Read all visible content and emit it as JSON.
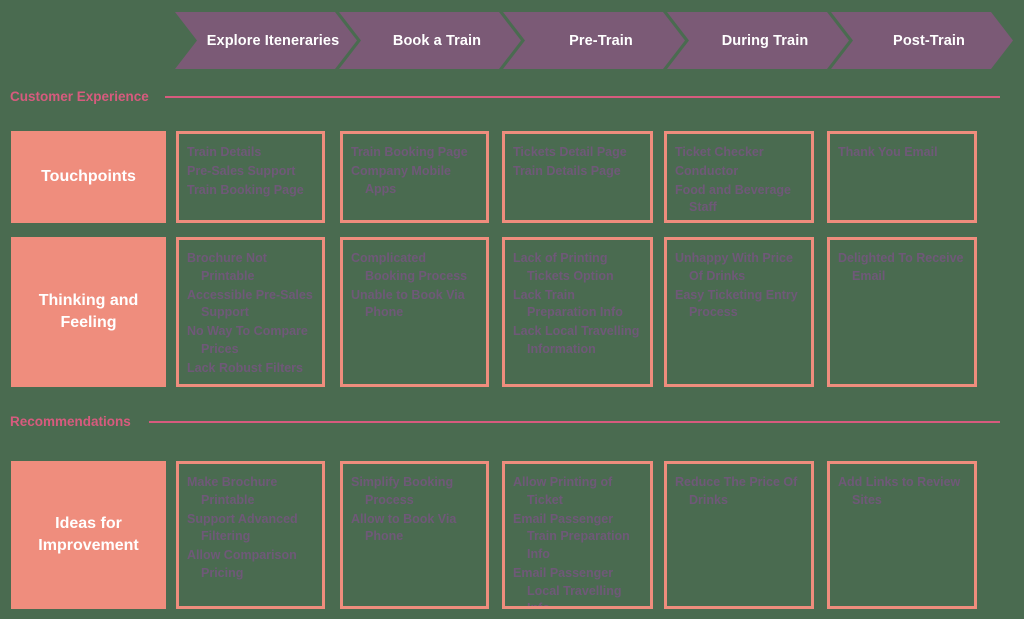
{
  "colors": {
    "background": "#4a6b50",
    "phase_bar": "#7b5a76",
    "accent_pink": "#d75b7e",
    "label_salmon": "#ef8d7d",
    "cell_text": "#6f5878",
    "phase_text": "#ffffff"
  },
  "phases": [
    {
      "label": "Explore Iteneraries"
    },
    {
      "label": "Book a Train"
    },
    {
      "label": "Pre-Train"
    },
    {
      "label": "During Train"
    },
    {
      "label": "Post-Train"
    }
  ],
  "sections": [
    {
      "id": "customer-experience",
      "title": "Customer Experience"
    },
    {
      "id": "recommendations",
      "title": "Recommendations"
    }
  ],
  "rows": [
    {
      "id": "touchpoints",
      "label": "Touchpoints",
      "cells": [
        {
          "items": [
            "Train Details",
            "Pre-Sales Support",
            "Train Booking Page"
          ]
        },
        {
          "items": [
            "Train Booking Page",
            "Company Mobile Apps"
          ]
        },
        {
          "items": [
            "Tickets Detail Page",
            "Train Details Page"
          ]
        },
        {
          "items": [
            "Ticket Checker",
            "Conductor",
            "Food and Beverage Staff"
          ]
        },
        {
          "items": [
            "Thank You Email"
          ]
        }
      ]
    },
    {
      "id": "thinking-and-feeling",
      "label": "Thinking and Feeling",
      "cells": [
        {
          "items": [
            "Brochure Not Printable",
            "Accessible Pre-Sales Support",
            "No Way To Compare Prices",
            "Lack Robust Filters"
          ]
        },
        {
          "items": [
            "Complicated Booking Process",
            "Unable to Book Via Phone"
          ]
        },
        {
          "items": [
            "Lack of Printing Tickets Option",
            "Lack Train Preparation Info",
            "Lack Local Travelling Information"
          ]
        },
        {
          "items": [
            "Unhappy With Price Of Drinks",
            "Easy Ticketing Entry Process"
          ]
        },
        {
          "items": [
            "Delighted To Receive Email"
          ]
        }
      ]
    },
    {
      "id": "ideas-for-improvement",
      "label": "Ideas for Improvement",
      "cells": [
        {
          "items": [
            "Make Brochure Printable",
            "Support Advanced Filtering",
            "Allow Comparison Pricing"
          ]
        },
        {
          "items": [
            "Simplify Booking Process",
            "Allow to Book Via Phone"
          ]
        },
        {
          "items": [
            "Allow Printing of Ticket",
            "Email Passenger Train Preparation Info",
            "Email Passenger Local Travelling Info"
          ]
        },
        {
          "items": [
            "Reduce The Price Of Drinks"
          ]
        },
        {
          "items": [
            "Add Links to Review Sites"
          ]
        }
      ]
    }
  ]
}
